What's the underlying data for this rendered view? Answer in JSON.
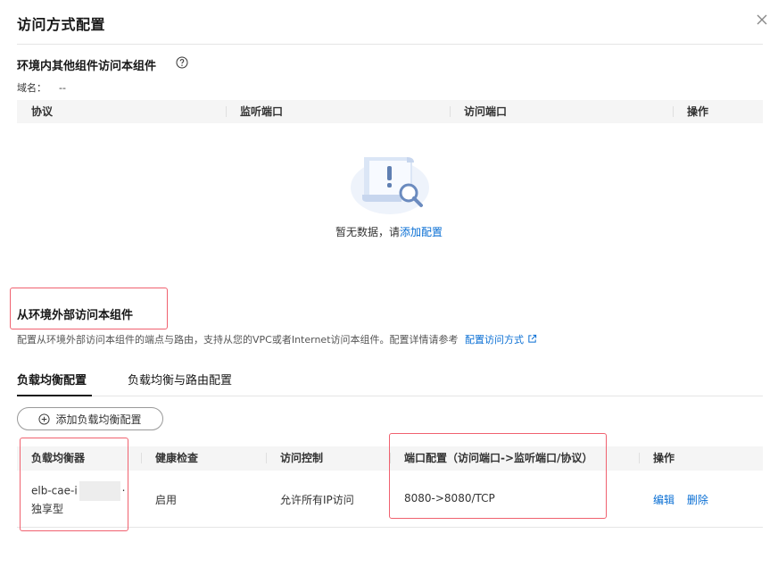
{
  "dialog": {
    "title": "访问方式配置"
  },
  "internal": {
    "title": "环境内其他组件访问本组件",
    "domain_label": "域名：",
    "domain_value": "--",
    "columns": [
      "协议",
      "监听端口",
      "访问端口",
      "操作"
    ],
    "empty_text": "暂无数据，请",
    "empty_link": "添加配置"
  },
  "external": {
    "title": "从环境外部访问本组件",
    "description": "配置从环境外部访问本组件的端点与路由，支持从您的VPC或者Internet访问本组件。配置详情请参考",
    "description_link": "配置访问方式"
  },
  "tabs": [
    {
      "label": "负载均衡配置",
      "active": true
    },
    {
      "label": "负载均衡与路由配置",
      "active": false
    }
  ],
  "add_button": "添加负载均衡配置",
  "lb_table": {
    "columns": [
      "负载均衡器",
      "健康检查",
      "访问控制",
      "端口配置（访问端口->监听端口/协议）",
      "操作"
    ],
    "rows": [
      {
        "lb_name_prefix": "elb-cae-i",
        "lb_name_suffix": "·",
        "lb_type": "独享型",
        "health": "启用",
        "access": "允许所有IP访问",
        "ports": "8080->8080/TCP",
        "edit": "编辑",
        "delete": "删除"
      }
    ]
  },
  "colors": {
    "link": "#0a6fd4",
    "highlight": "#f0616f",
    "header_bg": "#f5f5f5"
  }
}
